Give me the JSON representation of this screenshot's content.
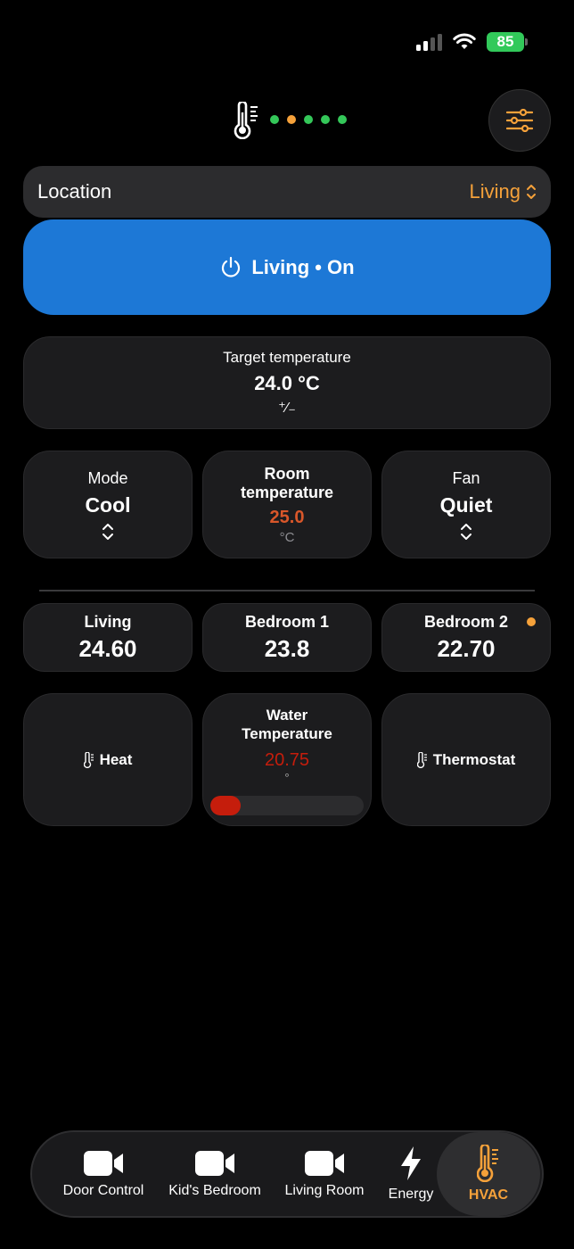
{
  "status_bar": {
    "battery": "85",
    "icons": [
      "cellular-signal-icon",
      "wifi-icon",
      "battery-charging-icon"
    ]
  },
  "header": {
    "icon": "thermometer-icon",
    "indicator_colors": [
      "#34c759",
      "#f5a13a",
      "#34c759",
      "#34c759",
      "#34c759"
    ],
    "filter_icon": "sliders-icon"
  },
  "location": {
    "label": "Location",
    "value": "Living"
  },
  "power": {
    "label": "Living • On",
    "state": "on",
    "color": "#1d78d6"
  },
  "target": {
    "title": "Target temperature",
    "value": "24.0 °C",
    "adjust_symbol": "⁺∕₋"
  },
  "mode": {
    "title": "Mode",
    "value": "Cool"
  },
  "room_temp": {
    "title_line1": "Room",
    "title_line2": "temperature",
    "value": "25.0",
    "unit": "°C",
    "value_color": "#d9572a"
  },
  "fan": {
    "title": "Fan",
    "value": "Quiet"
  },
  "zones": [
    {
      "name": "Living",
      "value": "24.60"
    },
    {
      "name": "Bedroom 1",
      "value": "23.8"
    },
    {
      "name": "Bedroom 2",
      "value": "22.70",
      "badge_color": "#f5a13a"
    }
  ],
  "tiles": {
    "heat": {
      "label": "Heat"
    },
    "water": {
      "title_line1": "Water",
      "title_line2": "Temperature",
      "value": "20.75",
      "unit": "°",
      "value_color": "#c51d0c",
      "level": 0.2
    },
    "thermostat": {
      "label": "Thermostat"
    }
  },
  "tabs": [
    {
      "label": "Door Control",
      "icon": "video-camera-icon"
    },
    {
      "label": "Kid's Bedroom",
      "icon": "video-camera-icon"
    },
    {
      "label": "Living Room",
      "icon": "video-camera-icon"
    },
    {
      "label": "Energy",
      "icon": "bolt-icon"
    },
    {
      "label": "HVAC",
      "icon": "thermometer-icon",
      "active": true
    }
  ],
  "colors": {
    "accent": "#f5a13a",
    "primary": "#1d78d6",
    "background": "#000000",
    "card": "#1c1c1e"
  }
}
